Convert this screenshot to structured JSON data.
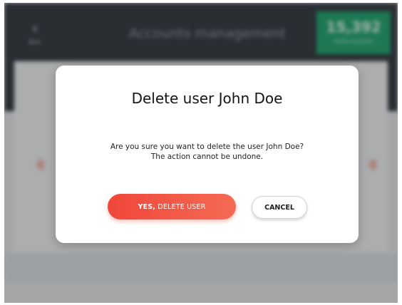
{
  "background_app": {
    "back_arrow_icon": "arrow-left-icon",
    "back_label": "Back",
    "title": "Accounts management",
    "stat": {
      "value": "15,392",
      "caption": "Active Accounts"
    }
  },
  "dialog": {
    "title": "Delete user John Doe",
    "message_line1": "Are you sure you want to delete the user John Doe?",
    "message_line2": "The action cannot be undone.",
    "confirm": {
      "label_bold": "YES,",
      "label_rest": " DELETE USER"
    },
    "cancel_label": "CANCEL"
  },
  "colors": {
    "topbar": "#2d3238",
    "stat_box": "#1aa36a",
    "confirm_gradient_start": "#f0473b",
    "confirm_gradient_end": "#f46a53"
  }
}
